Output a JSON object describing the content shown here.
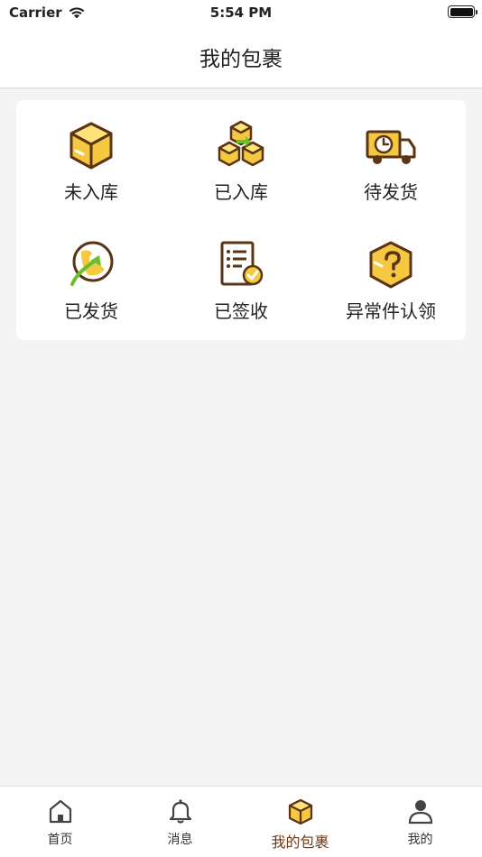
{
  "status_bar": {
    "carrier": "Carrier",
    "time": "5:54 PM"
  },
  "nav": {
    "title": "我的包裹"
  },
  "package_grid": [
    {
      "label": "未入库",
      "icon": "box-icon"
    },
    {
      "label": "已入库",
      "icon": "stacked-boxes-icon"
    },
    {
      "label": "待发货",
      "icon": "delivery-truck-icon"
    },
    {
      "label": "已发货",
      "icon": "globe-shipped-icon"
    },
    {
      "label": "已签收",
      "icon": "signed-document-icon"
    },
    {
      "label": "异常件认领",
      "icon": "question-box-icon"
    }
  ],
  "tabs": [
    {
      "label": "首页",
      "icon": "home-icon",
      "active": false
    },
    {
      "label": "消息",
      "icon": "bell-icon",
      "active": false
    },
    {
      "label": "我的包裹",
      "icon": "package-icon",
      "active": true
    },
    {
      "label": "我的",
      "icon": "user-icon",
      "active": false
    }
  ],
  "colors": {
    "brand_brown": "#6b3a14",
    "accent_yellow": "#f5c842",
    "accent_green": "#6cbf2a"
  }
}
